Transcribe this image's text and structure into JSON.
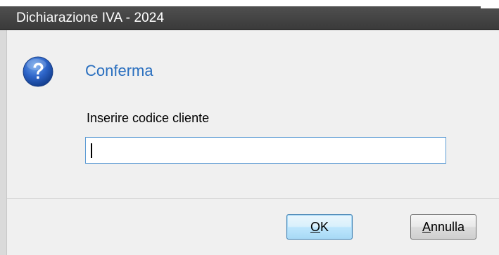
{
  "window": {
    "title": "Dichiarazione IVA - 2024"
  },
  "dialog": {
    "icon": "question-icon",
    "heading": "Conferma",
    "prompt": "Inserire codice cliente",
    "input_value": "",
    "accent_color": "#2a6fbf"
  },
  "buttons": {
    "ok_mnemonic": "O",
    "ok_rest": "K",
    "cancel_mnemonic": "A",
    "cancel_rest": "nnulla"
  }
}
